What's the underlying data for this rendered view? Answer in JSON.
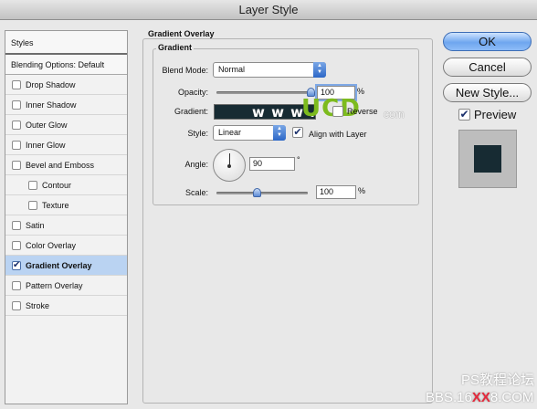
{
  "window": {
    "title": "Layer Style"
  },
  "sidebar": {
    "header": "Styles",
    "blending": "Blending Options: Default",
    "items": [
      {
        "label": "Drop Shadow",
        "checked": false,
        "sub": false
      },
      {
        "label": "Inner Shadow",
        "checked": false,
        "sub": false
      },
      {
        "label": "Outer Glow",
        "checked": false,
        "sub": false
      },
      {
        "label": "Inner Glow",
        "checked": false,
        "sub": false
      },
      {
        "label": "Bevel and Emboss",
        "checked": false,
        "sub": false
      },
      {
        "label": "Contour",
        "checked": false,
        "sub": true
      },
      {
        "label": "Texture",
        "checked": false,
        "sub": true
      },
      {
        "label": "Satin",
        "checked": false,
        "sub": false
      },
      {
        "label": "Color Overlay",
        "checked": false,
        "sub": false
      },
      {
        "label": "Gradient Overlay",
        "checked": true,
        "sub": false,
        "selected": true
      },
      {
        "label": "Pattern Overlay",
        "checked": false,
        "sub": false
      },
      {
        "label": "Stroke",
        "checked": false,
        "sub": false
      }
    ]
  },
  "panel": {
    "section_title": "Gradient Overlay",
    "group_title": "Gradient",
    "blend_mode": {
      "label": "Blend Mode:",
      "value": "Normal"
    },
    "opacity": {
      "label": "Opacity:",
      "value": "100",
      "unit": "%",
      "level": 1.0
    },
    "gradient": {
      "label": "Gradient:",
      "color": "#172b33",
      "reverse_label": "Reverse",
      "reverse_checked": false
    },
    "style": {
      "label": "Style:",
      "value": "Linear",
      "align_label": "Align with Layer",
      "align_checked": true
    },
    "angle": {
      "label": "Angle:",
      "value": "90",
      "unit": "°"
    },
    "scale": {
      "label": "Scale:",
      "value": "100",
      "unit": "%",
      "level": 0.45
    }
  },
  "buttons": {
    "ok": "OK",
    "cancel": "Cancel",
    "new_style": "New Style...",
    "preview_label": "Preview",
    "preview_checked": true
  },
  "preview": {
    "fill_color": "#172b33"
  },
  "watermarks": {
    "url_left": "w w w .",
    "logo": "UCD",
    "url_right": "com",
    "bottom_line1": "PS教程论坛",
    "bottom_line2_a": "BBS.16",
    "bottom_line2_b": "XX",
    "bottom_line2_c": "8.COM"
  }
}
